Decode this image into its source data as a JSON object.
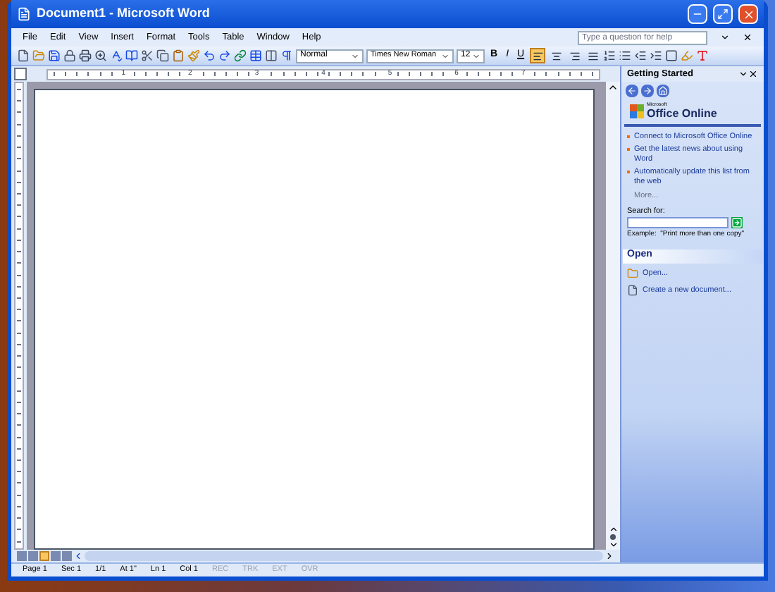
{
  "window": {
    "title": "Document1 - Microsoft Word"
  },
  "menu": [
    "File",
    "Edit",
    "View",
    "Insert",
    "Format",
    "Tools",
    "Table",
    "Window",
    "Help"
  ],
  "help_box": {
    "placeholder": "Type a question for help"
  },
  "toolbar": {
    "style": "Normal",
    "font": "Times New Roman",
    "size": "12",
    "bold": "B",
    "italic": "I",
    "underline": "U",
    "align_buttons": [
      {
        "selected": true
      },
      {
        "selected": false
      },
      {
        "selected": false
      },
      {
        "selected": false
      }
    ]
  },
  "ruler": {
    "numbers": [
      "1",
      "2",
      "3",
      "4",
      "5",
      "6",
      "7"
    ]
  },
  "task_pane": {
    "title": "Getting Started",
    "logo_small": "Microsoft",
    "logo": "Office Online",
    "links": [
      "Connect to Microsoft Office Online",
      "Get the latest news about using Word",
      "Automatically update this list from the web"
    ],
    "more": "More...",
    "search_label": "Search for:",
    "example": "Example:  \"Print more than one copy\"",
    "open_title": "Open",
    "open_items": [
      {
        "kind": "folder",
        "label": "Open..."
      },
      {
        "kind": "new",
        "label": "Create a new document..."
      }
    ]
  },
  "view_buttons": [
    {
      "selected": false
    },
    {
      "selected": false
    },
    {
      "selected": true
    },
    {
      "selected": false
    },
    {
      "selected": false
    }
  ],
  "status_bar": [
    {
      "text": "Page 1",
      "disabled": false
    },
    {
      "text": "Sec 1",
      "disabled": false
    },
    {
      "text": "1/1",
      "disabled": false
    },
    {
      "text": "At 1\"",
      "disabled": false
    },
    {
      "text": "Ln 1",
      "disabled": false
    },
    {
      "text": "Col 1",
      "disabled": false
    },
    {
      "text": "REC",
      "disabled": true
    },
    {
      "text": "TRK",
      "disabled": true
    },
    {
      "text": "EXT",
      "disabled": true
    },
    {
      "text": "OVR",
      "disabled": true
    }
  ]
}
